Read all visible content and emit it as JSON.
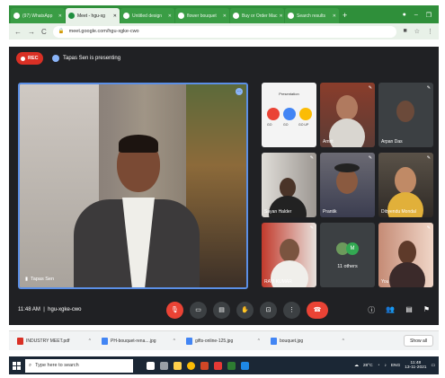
{
  "browser": {
    "tabs": [
      {
        "label": "(97) WhatsApp",
        "active": false
      },
      {
        "label": "Meet - hgu-xg",
        "active": true
      },
      {
        "label": "Untitled design",
        "active": false
      },
      {
        "label": "flower bouquet",
        "active": false
      },
      {
        "label": "Buy or Order Mac",
        "active": false
      },
      {
        "label": "Search results",
        "active": false
      }
    ],
    "new_tab": "+",
    "url": "meet.google.com/hgu-xgke-cwo"
  },
  "meet": {
    "rec_label": "REC",
    "presenting_text": "Tapas Sen is presenting",
    "main_tile_name": "Tapas Sen",
    "participants": [
      {
        "name": "",
        "kind": "presentation"
      },
      {
        "name": "Amrit",
        "kind": "video"
      },
      {
        "name": "Arpan Das",
        "kind": "video"
      },
      {
        "name": "Sayan Halder",
        "kind": "video"
      },
      {
        "name": "Prantik",
        "kind": "video"
      },
      {
        "name": "Dibyendu Mondal",
        "kind": "video"
      },
      {
        "name": "RAVI KUMAR",
        "kind": "video"
      },
      {
        "name": "11 others",
        "kind": "others"
      },
      {
        "name": "You",
        "kind": "video"
      }
    ],
    "presentation_thumb_title": "Presentation",
    "presentation_thumb_labels": [
      "GO",
      "GO",
      "GO UP"
    ],
    "time": "11:48 AM",
    "meeting_code": "hgu-xgke-cwo",
    "others_avatar_letter": "M"
  },
  "downloads": [
    {
      "name": "INDUSTRY MEET.pdf",
      "type": "pdf"
    },
    {
      "name": "PH-bouquet-rena....jpg",
      "type": "img"
    },
    {
      "name": "gifts-online-125.jpg",
      "type": "img"
    },
    {
      "name": "bouquet.jpg",
      "type": "img"
    }
  ],
  "show_all": "Show all",
  "taskbar": {
    "search_placeholder": "Type here to search",
    "temperature": "28°C",
    "lang": "ENG",
    "time": "11:48",
    "date": "13-11-2021"
  },
  "colors": {
    "browser_frame": "#2f8f3a",
    "meet_bg": "#202124",
    "rec": "#d93025",
    "active_speaker_border": "#5b8fe6"
  }
}
